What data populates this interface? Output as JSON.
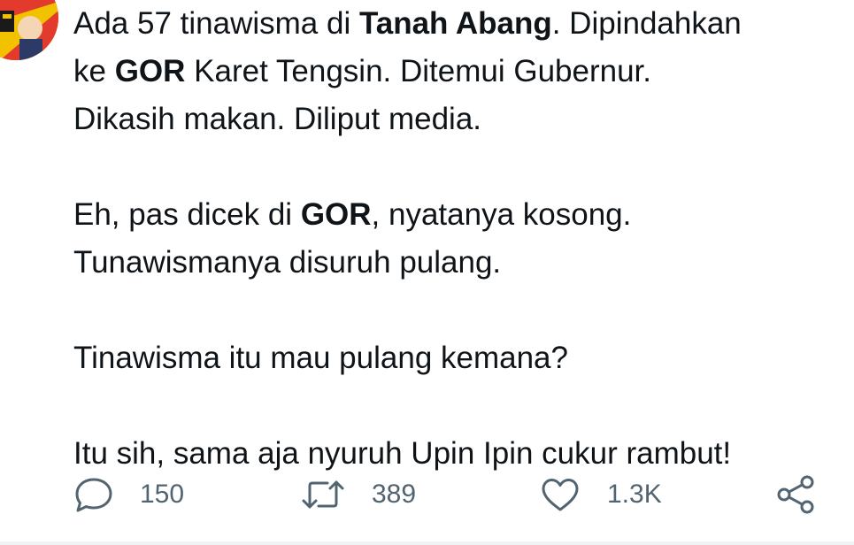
{
  "tweet": {
    "paragraphs": [
      [
        {
          "text": "Ada 57 tinawisma di ",
          "bold": false
        },
        {
          "text": "Tanah Abang",
          "bold": true
        },
        {
          "text": ". Dipindahkan",
          "bold": false
        }
      ],
      [
        {
          "text": "ke ",
          "bold": false
        },
        {
          "text": "GOR",
          "bold": true
        },
        {
          "text": " Karet Tengsin. Ditemui Gubernur.",
          "bold": false
        }
      ],
      [
        {
          "text": "Dikasih makan. Diliput media.",
          "bold": false
        }
      ],
      null,
      [
        {
          "text": "Eh, pas dicek di ",
          "bold": false
        },
        {
          "text": "GOR",
          "bold": true
        },
        {
          "text": ", nyatanya kosong.",
          "bold": false
        }
      ],
      [
        {
          "text": "Tunawismanya disuruh pulang.",
          "bold": false
        }
      ],
      null,
      [
        {
          "text": "Tinawisma itu mau pulang kemana?",
          "bold": false
        }
      ],
      null,
      [
        {
          "text": "Itu sih, sama aja nyuruh Upin Ipin cukur rambut!",
          "bold": false
        }
      ]
    ]
  },
  "actions": {
    "reply": {
      "icon": "reply-icon",
      "count": "150"
    },
    "retweet": {
      "icon": "retweet-icon",
      "count": "389"
    },
    "like": {
      "icon": "heart-icon",
      "count": "1.3K"
    },
    "share": {
      "icon": "share-icon"
    }
  },
  "colors": {
    "text": "#0f1419",
    "muted": "#536471",
    "divider": "#eff3f4"
  }
}
